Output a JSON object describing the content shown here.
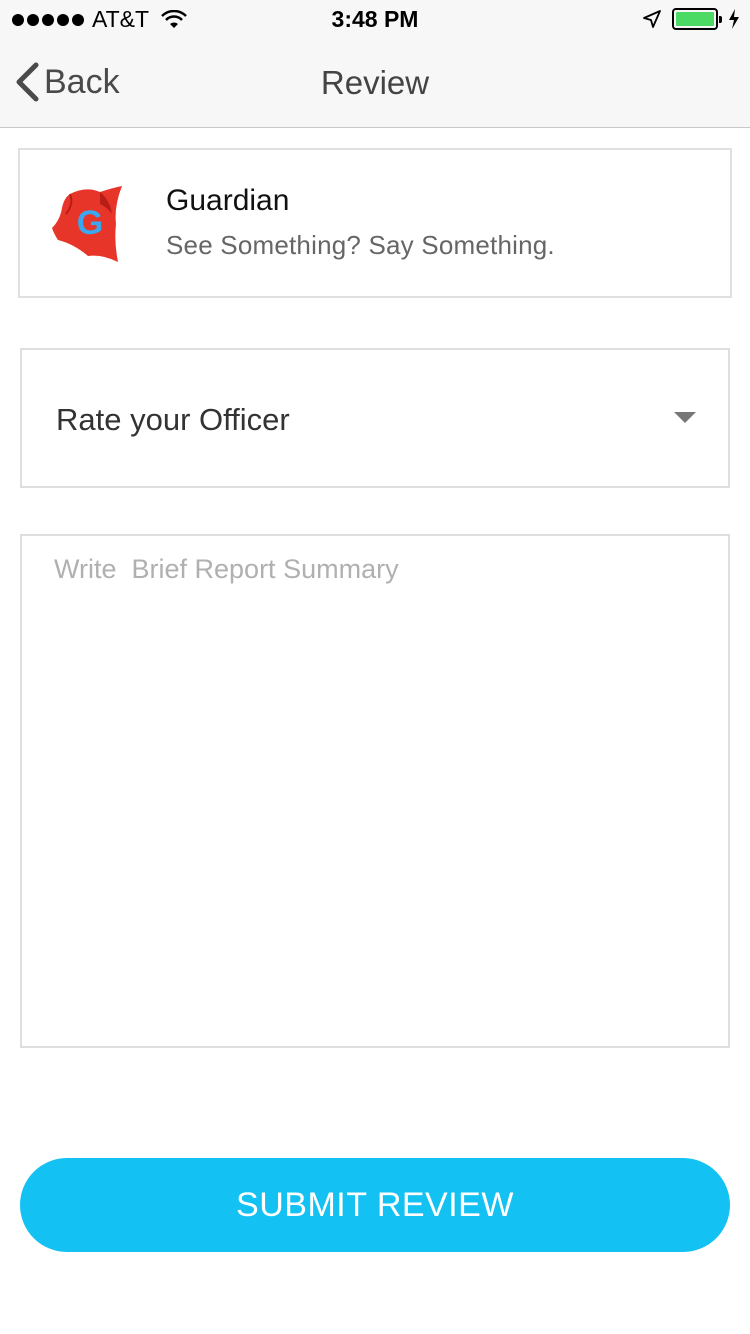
{
  "status_bar": {
    "carrier": "AT&T",
    "time": "3:48 PM",
    "battery_color": "#4cd964"
  },
  "nav": {
    "back_label": "Back",
    "title": "Review"
  },
  "app": {
    "logo_letter": "G",
    "name": "Guardian",
    "tagline": "See Something? Say Something.",
    "logo_cape_color": "#e8352a",
    "logo_letter_color": "#3aa8f0"
  },
  "rating": {
    "label": "Rate your Officer"
  },
  "summary": {
    "placeholder": "Write  Brief Report Summary",
    "value": ""
  },
  "submit": {
    "label": "SUBMIT REVIEW",
    "color": "#13c2f2"
  }
}
